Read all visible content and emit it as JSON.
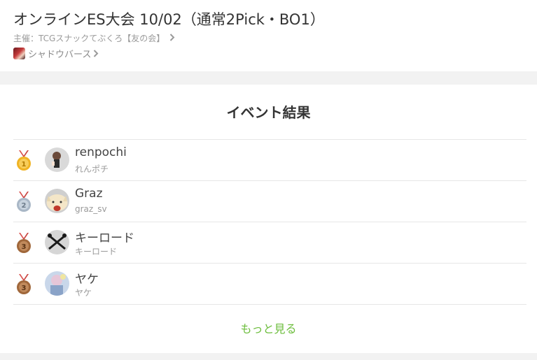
{
  "event": {
    "title": "オンラインES大会 10/02（通常2Pick・BO1）",
    "organizer": "主催：TCGスナックてぶくろ【友の会】",
    "game": "シャドウバース"
  },
  "results": {
    "heading": "イベント結果",
    "entries": [
      {
        "rank": "1",
        "name": "renpochi",
        "handle": "れんポチ"
      },
      {
        "rank": "2",
        "name": "Graz",
        "handle": "graz_sv"
      },
      {
        "rank": "3",
        "name": "キーロード",
        "handle": "キーロード"
      },
      {
        "rank": "3",
        "name": "ヤケ",
        "handle": "ヤケ"
      }
    ],
    "more_label": "もっと見る"
  },
  "colors": {
    "gold": "#f0b323",
    "silver": "#a9b7c6",
    "bronze": "#a0673a",
    "ribbon": "#d9534f",
    "link": "#6cbd3c"
  }
}
